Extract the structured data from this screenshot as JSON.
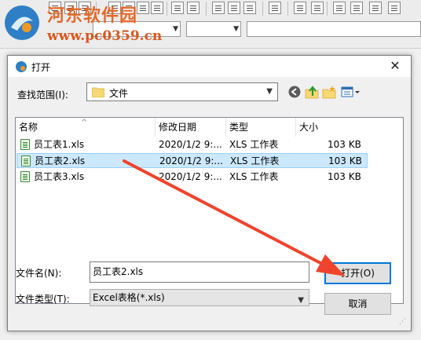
{
  "app": {
    "watermark_text": "河东软件园",
    "watermark_url": "www.pc0359.cn"
  },
  "dialog": {
    "title": "打开",
    "close_glyph": "✕",
    "lookin_label": "查找范围(I):",
    "lookin_value": "文件",
    "columns": [
      "名称",
      "修改日期",
      "类型",
      "大小"
    ],
    "files": [
      {
        "name": "员工表1.xls",
        "modified": "2020/1/2 9:...",
        "type": "XLS 工作表",
        "size": "103 KB",
        "selected": false
      },
      {
        "name": "员工表2.xls",
        "modified": "2020/1/2 9:...",
        "type": "XLS 工作表",
        "size": "103 KB",
        "selected": true
      },
      {
        "name": "员工表3.xls",
        "modified": "2020/1/2 9:...",
        "type": "XLS 工作表",
        "size": "103 KB",
        "selected": false
      }
    ],
    "filename_label": "文件名(N):",
    "filename_value": "员工表2.xls",
    "filetype_label": "文件类型(T):",
    "filetype_value": "Excel表格(*.xls)",
    "open_button": "打开(O)",
    "cancel_button": "取消"
  },
  "colors": {
    "selection": "#cce8ff",
    "accent": "#0078d7",
    "annotation_arrow": "#f0432d"
  },
  "icons": [
    "excel-file-icon",
    "folder-icon",
    "back-icon",
    "up-folder-icon",
    "new-folder-icon",
    "view-menu-icon",
    "close-icon"
  ]
}
